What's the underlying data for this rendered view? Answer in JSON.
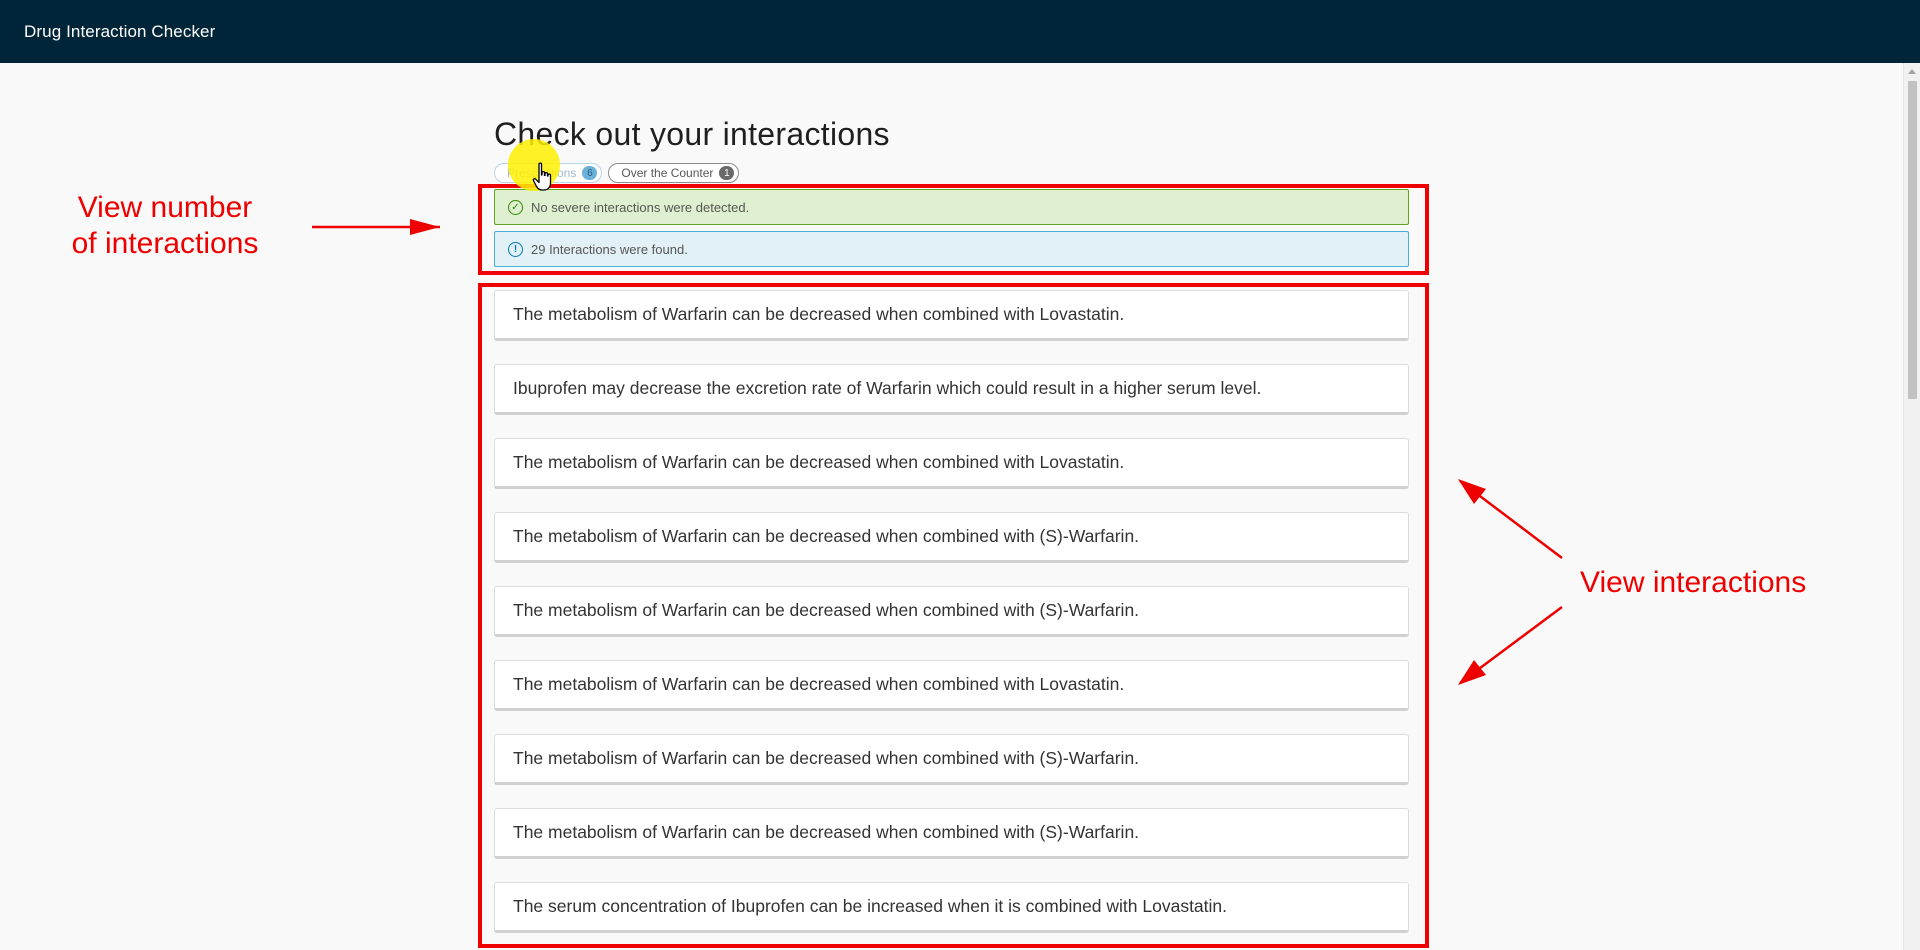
{
  "app": {
    "title": "Drug Interaction Checker"
  },
  "main": {
    "title": "Check out your interactions",
    "tabs": [
      {
        "label": "Prescriptions",
        "count": "6",
        "active": true
      },
      {
        "label": "Over the Counter",
        "count": "1",
        "active": false
      }
    ],
    "alerts": {
      "success": "No severe interactions were detected.",
      "info": "29 Interactions were found."
    },
    "interactions": [
      "The metabolism of Warfarin can be decreased when combined with Lovastatin.",
      "Ibuprofen may decrease the excretion rate of Warfarin which could result in a higher serum level.",
      "The metabolism of Warfarin can be decreased when combined with Lovastatin.",
      "The metabolism of Warfarin can be decreased when combined with (S)-Warfarin.",
      "The metabolism of Warfarin can be decreased when combined with (S)-Warfarin.",
      "The metabolism of Warfarin can be decreased when combined with Lovastatin.",
      "The metabolism of Warfarin can be decreased when combined with (S)-Warfarin.",
      "The metabolism of Warfarin can be decreased when combined with (S)-Warfarin.",
      "The serum concentration of Ibuprofen can be increased when it is combined with Lovastatin."
    ]
  },
  "annotations": {
    "number_label_line1": "View number",
    "number_label_line2": "of interactions",
    "interactions_label": "View interactions",
    "color": "#ee0000"
  },
  "icons": {
    "success": "check-circle-icon",
    "info": "info-circle-icon",
    "cursor": "hand-pointer-icon"
  }
}
